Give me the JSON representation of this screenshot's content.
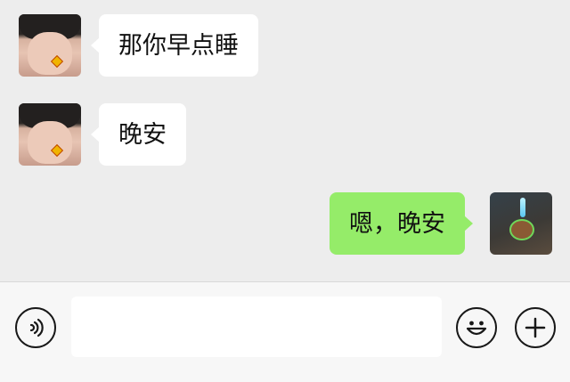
{
  "messages": [
    {
      "side": "left",
      "text": "那你早点睡"
    },
    {
      "side": "left",
      "text": "晚安"
    },
    {
      "side": "right",
      "text": "嗯，晚安"
    }
  ],
  "input": {
    "value": "",
    "placeholder": ""
  },
  "icons": {
    "voice": "voice-wave-icon",
    "emoji": "smiley-icon",
    "more": "plus-circle-icon"
  },
  "colors": {
    "background": "#ededed",
    "incoming_bubble": "#ffffff",
    "outgoing_bubble": "#95ec69",
    "input_bar": "#f7f7f7"
  }
}
